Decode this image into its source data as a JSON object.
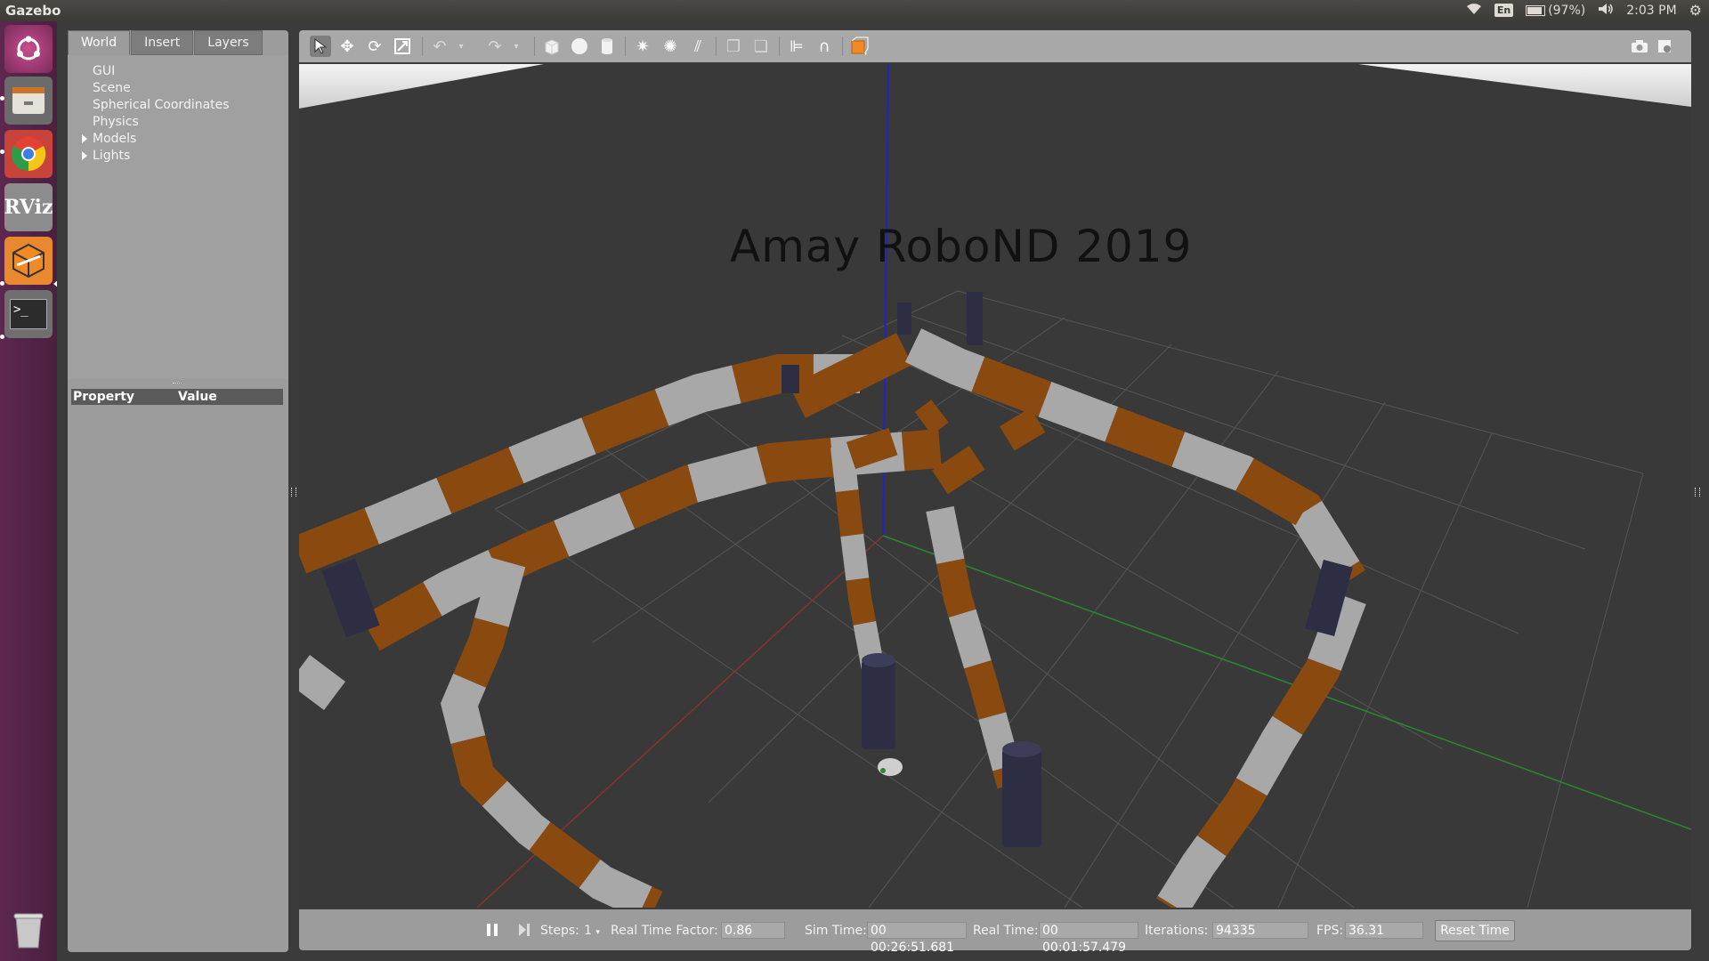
{
  "topbar": {
    "app_name": "Gazebo",
    "lang": "En",
    "battery": "(97%)",
    "time": "2:03 PM"
  },
  "launcher": {
    "items": [
      "dash-icon",
      "files-icon",
      "chrome-icon",
      "rviz-icon",
      "gazebo-icon",
      "terminal-icon",
      "trash-icon"
    ],
    "rviz_label": "RViz"
  },
  "left_panel": {
    "tabs": [
      "World",
      "Insert",
      "Layers"
    ],
    "tree": [
      "GUI",
      "Scene",
      "Spherical Coordinates",
      "Physics",
      "Models",
      "Lights"
    ],
    "property_header": "Property",
    "value_header": "Value"
  },
  "viewport": {
    "title": "Amay RoboND 2019"
  },
  "bottom_bar": {
    "steps_label": "Steps:",
    "steps_value": "1",
    "rtf_label": "Real Time Factor:",
    "rtf_value": "0.86",
    "sim_time_label": "Sim Time:",
    "sim_time_value": "00 00:26:51.681",
    "real_time_label": "Real Time:",
    "real_time_value": "00 00:01:57.479",
    "iterations_label": "Iterations:",
    "iterations_value": "94335",
    "fps_label": "FPS:",
    "fps_value": "36.31",
    "reset_label": "Reset Time"
  },
  "colors": {
    "launcher": "#5e2750",
    "panel": "#9c9c9c",
    "wall_orange": "#8a4a0f",
    "wall_gray": "#a9a9a9",
    "pillar": "#2f3044",
    "floor": "#3a3a3a"
  }
}
